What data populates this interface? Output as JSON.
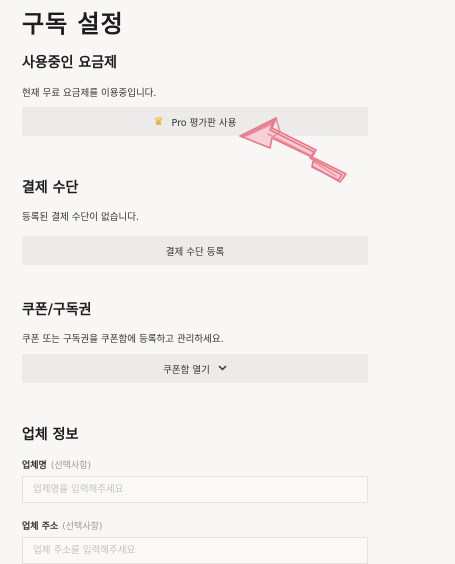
{
  "page": {
    "title": "구독 설정"
  },
  "plan": {
    "heading": "사용중인 요금제",
    "description": "현재 무료 요금제를 이용중입니다.",
    "trial_button": "Pro 평가판 사용",
    "trial_icon": "crown-icon",
    "accent_color": "#e0a61c"
  },
  "payment": {
    "heading": "결제 수단",
    "description": "등록된 결제 수단이 없습니다.",
    "register_button": "결제 수단 등록"
  },
  "coupon": {
    "heading": "쿠폰/구독권",
    "description": "쿠폰 또는 구독권을 쿠폰함에 등록하고 관리하세요.",
    "open_button": "쿠폰함 열기",
    "open_icon": "chevron-down-icon"
  },
  "company": {
    "heading": "업체 정보",
    "name_label": "업체명",
    "name_optional": "(선택사항)",
    "name_placeholder": "업체명을 입력해주세요",
    "address_label": "업체 주소",
    "address_optional": "(선택사항)",
    "address_placeholder": "업체 주소를 입력해주세요"
  },
  "annotation": {
    "arrow_color": "#e8798a"
  }
}
